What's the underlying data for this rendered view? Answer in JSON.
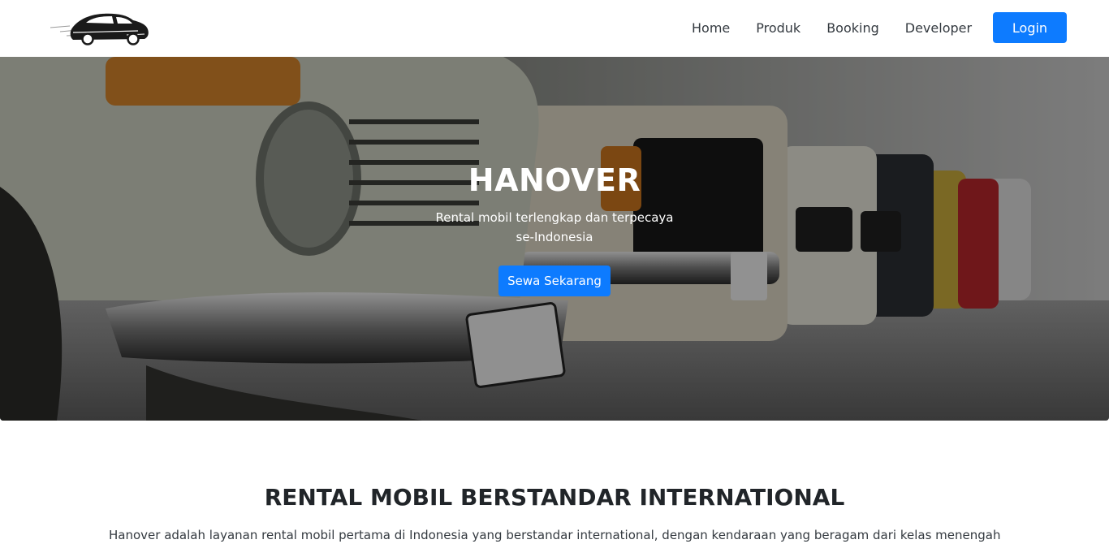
{
  "navbar": {
    "logo_icon": "car-logo-icon",
    "links": [
      "Home",
      "Produk",
      "Booking",
      "Developer"
    ],
    "login_label": "Login"
  },
  "hero": {
    "title": "HANOVER",
    "subtitle_line1": "Rental mobil terlengkap dan terpecaya",
    "subtitle_line2": "se-Indonesia",
    "cta_label": "Sewa Sekarang",
    "background_image": "row-of-vintage-cars-photo"
  },
  "about": {
    "title": "RENTAL MOBIL BERSTANDAR INTERNATIONAL",
    "text": "Hanover adalah layanan rental mobil pertama di Indonesia yang berstandar international, dengan kendaraan yang beragam dari kelas menengah"
  },
  "colors": {
    "primary": "#0d7bff",
    "nav_text": "#343a40",
    "heading": "#212529"
  }
}
